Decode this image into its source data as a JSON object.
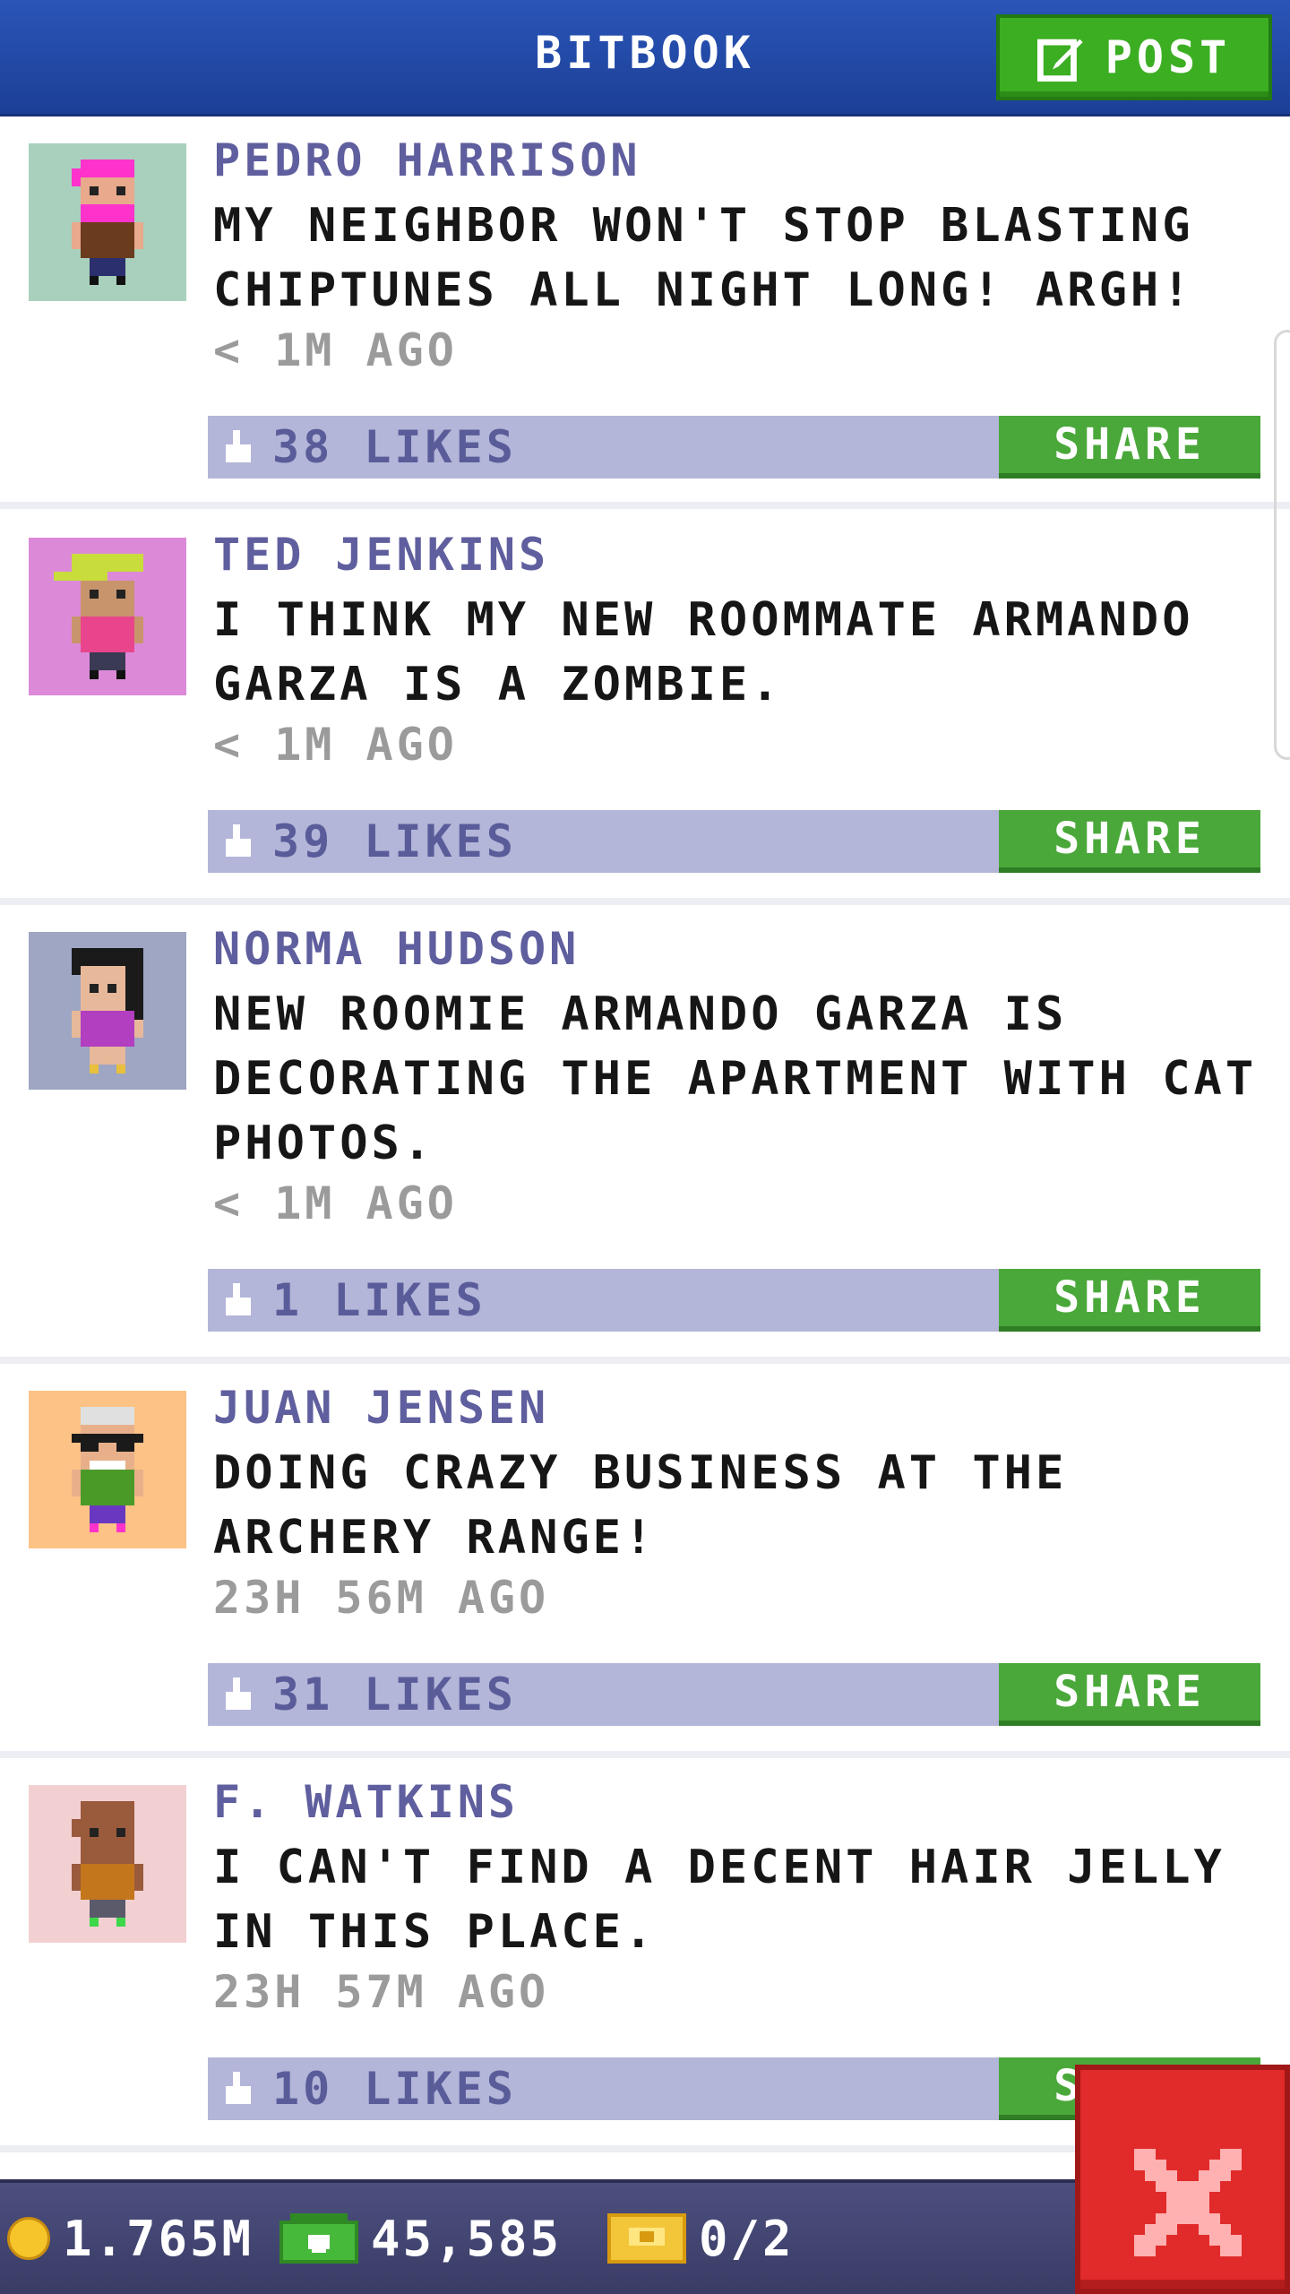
{
  "header": {
    "title": "BITBOOK",
    "post_label": "POST"
  },
  "posts": [
    {
      "author": "PEDRO HARRISON",
      "message": "MY NEIGHBOR WON'T STOP BLASTING CHIPTUNES ALL NIGHT LONG! ARGH!",
      "time": "< 1M AGO",
      "likes": "38 LIKES",
      "share_label": "SHARE",
      "avatar_bg": "#a8d0bc"
    },
    {
      "author": "TED JENKINS",
      "message": "I THINK MY NEW ROOMMATE ARMANDO GARZA IS A ZOMBIE.",
      "time": "< 1M AGO",
      "likes": "39 LIKES",
      "share_label": "SHARE",
      "avatar_bg": "#dc8ad8"
    },
    {
      "author": "NORMA HUDSON",
      "message": "NEW ROOMIE ARMANDO GARZA IS DECORATING THE APARTMENT WITH CAT PHOTOS.",
      "time": "< 1M AGO",
      "likes": "1 LIKES",
      "share_label": "SHARE",
      "avatar_bg": "#9ea6c4"
    },
    {
      "author": "JUAN JENSEN",
      "message": "DOING CRAZY BUSINESS AT THE ARCHERY RANGE!",
      "time": "23H 56M AGO",
      "likes": "31 LIKES",
      "share_label": "SHARE",
      "avatar_bg": "#fcc286"
    },
    {
      "author": "F. WATKINS",
      "message": "I CAN'T FIND A DECENT HAIR JELLY IN THIS PLACE.",
      "time": "23H 57M AGO",
      "likes": "10 LIKES",
      "share_label": "SHARE",
      "avatar_bg": "#f2d0d2"
    }
  ],
  "bottom_bar": {
    "coins": "1.765M",
    "bux": "45,585",
    "tickets": "0/2"
  },
  "colors": {
    "header": "#1c3f96",
    "accent_green": "#3cae22",
    "likes_bar": "#b3b6d8",
    "close_red": "#e12a2a"
  }
}
